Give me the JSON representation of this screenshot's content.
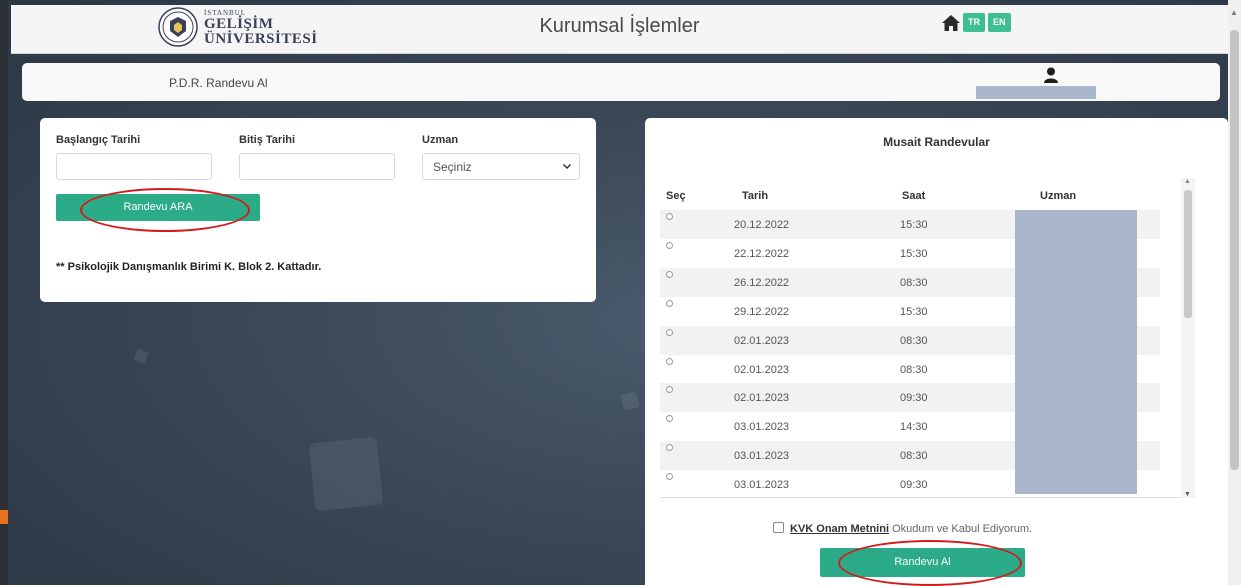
{
  "header": {
    "logo": {
      "line1": "İSTANBUL",
      "line2": "GELİŞİM",
      "line3": "ÜNİVERSİTESİ"
    },
    "title": "Kurumsal İşlemler",
    "home_icon": "home-icon",
    "languages": [
      "TR",
      "EN"
    ]
  },
  "breadcrumb": {
    "label": "P.D.R. Randevu Al",
    "user_icon": "user-icon"
  },
  "search": {
    "start_label": "Başlangıç Tarihi",
    "start_value": "",
    "end_label": "Bitiş Tarihi",
    "end_value": "",
    "expert_label": "Uzman",
    "expert_selected": "Seçiniz",
    "search_button": "Randevu ARA",
    "note": "** Psikolojik Danışmanlık Birimi K. Blok 2. Kattadır."
  },
  "availability": {
    "title": "Musait Randevular",
    "columns": [
      "Seç",
      "Tarih",
      "Saat",
      "Uzman"
    ],
    "rows": [
      {
        "date": "20.12.2022",
        "time": "15:30"
      },
      {
        "date": "22.12.2022",
        "time": "15:30"
      },
      {
        "date": "26.12.2022",
        "time": "08:30"
      },
      {
        "date": "29.12.2022",
        "time": "15:30"
      },
      {
        "date": "02.01.2023",
        "time": "08:30"
      },
      {
        "date": "02.01.2023",
        "time": "08:30"
      },
      {
        "date": "02.01.2023",
        "time": "09:30"
      },
      {
        "date": "03.01.2023",
        "time": "14:30"
      },
      {
        "date": "03.01.2023",
        "time": "08:30"
      },
      {
        "date": "03.01.2023",
        "time": "09:30"
      }
    ],
    "kvk_link": "KVK Onam Metnini",
    "kvk_text": " Okudum ve Kabul Ediyorum.",
    "kvk_checked": false,
    "submit_button": "Randevu Al"
  },
  "colors": {
    "accent_green": "#2bab88",
    "lang_green": "#3dbf8f",
    "annotation_red": "#d21c1c",
    "redaction_blue": "#aab6c9"
  }
}
